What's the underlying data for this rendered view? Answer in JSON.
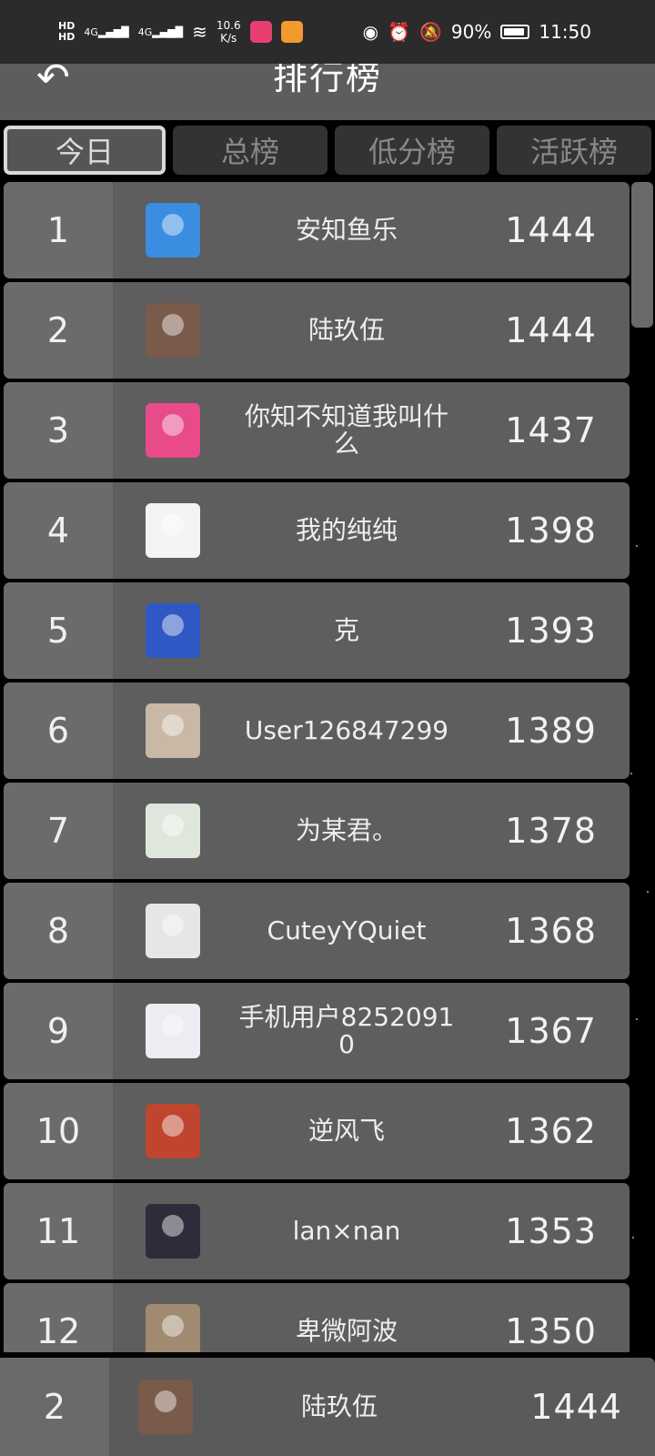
{
  "status_bar": {
    "hd1": "HD",
    "hd2": "HD",
    "net1": "4G",
    "net2": "4G",
    "speed_value": "10.6",
    "speed_unit": "K/s",
    "battery": "90%",
    "time": "11:50",
    "app1_color": "#e83f72",
    "app2_color": "#f29a2f"
  },
  "header": {
    "title": "排行榜",
    "back_icon": "back-arrow-icon"
  },
  "tabs": [
    {
      "label": "今日",
      "active": true
    },
    {
      "label": "总榜",
      "active": false
    },
    {
      "label": "低分榜",
      "active": false
    },
    {
      "label": "活跃榜",
      "active": false
    }
  ],
  "leaderboard": [
    {
      "rank": "1",
      "name": "安知鱼乐",
      "score": "1444",
      "avatar_color": "#3a8de0"
    },
    {
      "rank": "2",
      "name": "陆玖伍",
      "score": "1444",
      "avatar_color": "#7a5a4a"
    },
    {
      "rank": "3",
      "name": "你知不知道我叫什么",
      "score": "1437",
      "avatar_color": "#e84a8a"
    },
    {
      "rank": "4",
      "name": "我的纯纯",
      "score": "1398",
      "avatar_color": "#f4f4f4"
    },
    {
      "rank": "5",
      "name": "克",
      "score": "1393",
      "avatar_color": "#2f58c4"
    },
    {
      "rank": "6",
      "name": "User126847299",
      "score": "1389",
      "avatar_color": "#c9b8a6"
    },
    {
      "rank": "7",
      "name": "为某君。",
      "score": "1378",
      "avatar_color": "#dfe7dc"
    },
    {
      "rank": "8",
      "name": "CuteyYQuiet",
      "score": "1368",
      "avatar_color": "#e6e6e6"
    },
    {
      "rank": "9",
      "name": "手机用户82520910",
      "score": "1367",
      "avatar_color": "#ececf2"
    },
    {
      "rank": "10",
      "name": "逆风飞",
      "score": "1362",
      "avatar_color": "#c0452e"
    },
    {
      "rank": "11",
      "name": "lan×nan",
      "score": "1353",
      "avatar_color": "#2c2c3a"
    },
    {
      "rank": "12",
      "name": "卑微阿波",
      "score": "1350",
      "avatar_color": "#a08a70"
    }
  ],
  "my_entry": {
    "rank": "2",
    "name": "陆玖伍",
    "score": "1444",
    "avatar_color": "#7a5a4a"
  }
}
